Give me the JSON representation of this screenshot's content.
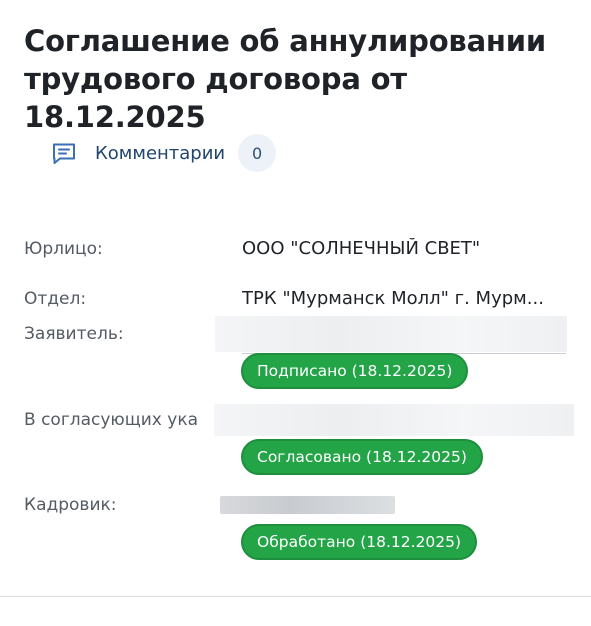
{
  "document": {
    "title": "Соглашение об аннулировании трудового договора от 18.12.2025"
  },
  "comments": {
    "label": "Комментарии",
    "count": "0",
    "icon": "comment-icon"
  },
  "fields": {
    "legal_entity": {
      "label": "Юрлицо:",
      "value": "ООО \"СОЛНЕЧНЫЙ СВЕТ\""
    },
    "department": {
      "label": "Отдел:",
      "value": "ТРК \"Мурманск Молл\" г. Мурм..."
    },
    "applicant": {
      "label": "Заявитель:",
      "status": "Подписано (18.12.2025)"
    },
    "approvers": {
      "label": "В согласующих ука",
      "status": "Согласовано (18.12.2025)"
    },
    "hr": {
      "label": "Кадровик:",
      "status": "Обработано (18.12.2025)"
    }
  },
  "colors": {
    "status_green": "#22a447",
    "accent_blue": "#22456e"
  }
}
